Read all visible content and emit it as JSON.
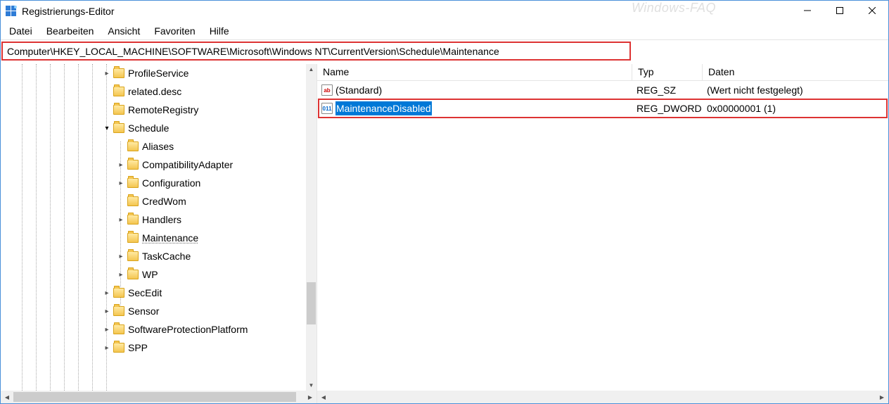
{
  "title": "Registrierungs-Editor",
  "watermark": "Windows-FAQ",
  "menu": {
    "file": "Datei",
    "edit": "Bearbeiten",
    "view": "Ansicht",
    "favorites": "Favoriten",
    "help": "Hilfe"
  },
  "address": "Computer\\HKEY_LOCAL_MACHINE\\SOFTWARE\\Microsoft\\Windows NT\\CurrentVersion\\Schedule\\Maintenance",
  "tree": [
    {
      "label": "ProfileService",
      "level": 7,
      "twisty": ">"
    },
    {
      "label": "related.desc",
      "level": 7,
      "twisty": ""
    },
    {
      "label": "RemoteRegistry",
      "level": 7,
      "twisty": ""
    },
    {
      "label": "Schedule",
      "level": 7,
      "twisty": "v"
    },
    {
      "label": "Aliases",
      "level": 8,
      "twisty": ""
    },
    {
      "label": "CompatibilityAdapter",
      "level": 8,
      "twisty": ">"
    },
    {
      "label": "Configuration",
      "level": 8,
      "twisty": ">"
    },
    {
      "label": "CredWom",
      "level": 8,
      "twisty": ""
    },
    {
      "label": "Handlers",
      "level": 8,
      "twisty": ">"
    },
    {
      "label": "Maintenance",
      "level": 8,
      "twisty": "",
      "selected": true
    },
    {
      "label": "TaskCache",
      "level": 8,
      "twisty": ">"
    },
    {
      "label": "WP",
      "level": 8,
      "twisty": ">"
    },
    {
      "label": "SecEdit",
      "level": 7,
      "twisty": ">"
    },
    {
      "label": "Sensor",
      "level": 7,
      "twisty": ">"
    },
    {
      "label": "SoftwareProtectionPlatform",
      "level": 7,
      "twisty": ">"
    },
    {
      "label": "SPP",
      "level": 7,
      "twisty": ">"
    }
  ],
  "columns": {
    "name": "Name",
    "type": "Typ",
    "data": "Daten"
  },
  "values": [
    {
      "name": "(Standard)",
      "type": "REG_SZ",
      "data": "(Wert nicht festgelegt)",
      "kind": "sz",
      "icon_text": "ab"
    },
    {
      "name": "MaintenanceDisabled",
      "type": "REG_DWORD",
      "data": "0x00000001 (1)",
      "kind": "dw",
      "icon_text": "011",
      "selected": true
    }
  ]
}
